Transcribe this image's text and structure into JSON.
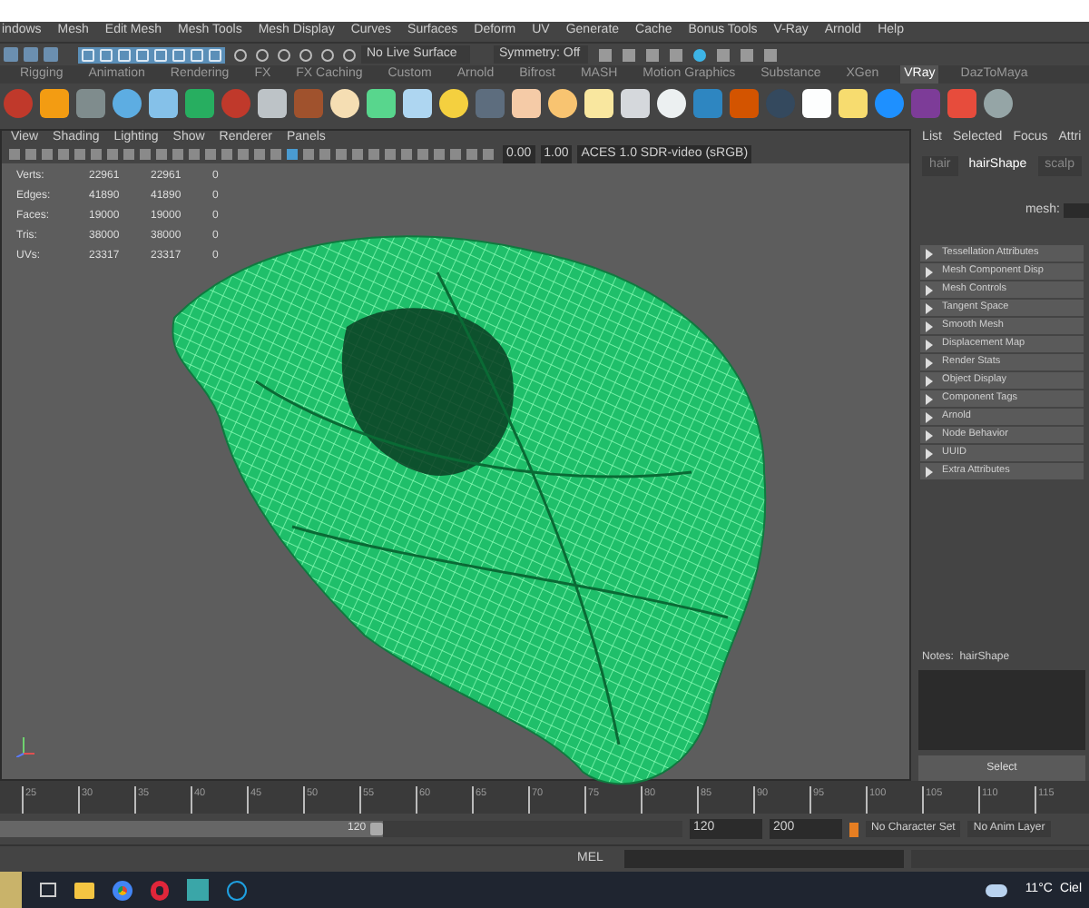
{
  "menu_bar": [
    "indows",
    "Mesh",
    "Edit Mesh",
    "Mesh Tools",
    "Mesh Display",
    "Curves",
    "Surfaces",
    "Deform",
    "UV",
    "Generate",
    "Cache",
    "Bonus Tools",
    "V-Ray",
    "Arnold",
    "Help"
  ],
  "status_line": {
    "live_surface": "No Live Surface",
    "symmetry": "Symmetry: Off"
  },
  "shelf_tabs": [
    {
      "label": "Rigging",
      "selected": false
    },
    {
      "label": "Animation",
      "selected": false
    },
    {
      "label": "Rendering",
      "selected": false
    },
    {
      "label": "FX",
      "selected": false
    },
    {
      "label": "FX Caching",
      "selected": false
    },
    {
      "label": "Custom",
      "selected": false
    },
    {
      "label": "Arnold",
      "selected": false
    },
    {
      "label": "Bifrost",
      "selected": false
    },
    {
      "label": "MASH",
      "selected": false
    },
    {
      "label": "Motion Graphics",
      "selected": false
    },
    {
      "label": "Substance",
      "selected": false
    },
    {
      "label": "XGen",
      "selected": false
    },
    {
      "label": "VRay",
      "selected": true
    },
    {
      "label": "DazToMaya",
      "selected": false
    }
  ],
  "viewport": {
    "menu": [
      "View",
      "Shading",
      "Lighting",
      "Show",
      "Renderer",
      "Panels"
    ],
    "color_management": {
      "exposure": "0.00",
      "gamma": "1.00",
      "view": "ACES 1.0 SDR-video (sRGB)"
    },
    "hud": [
      {
        "label": "Verts:",
        "column_2": "22961",
        "column_3": "22961",
        "column_4": "0"
      },
      {
        "label": "Edges:",
        "column_2": "41890",
        "column_3": "41890",
        "column_4": "0"
      },
      {
        "label": "Faces:",
        "column_2": "19000",
        "column_3": "19000",
        "column_4": "0"
      },
      {
        "label": "Tris:",
        "column_2": "38000",
        "column_3": "38000",
        "column_4": "0"
      },
      {
        "label": "UVs:",
        "column_2": "23317",
        "column_3": "23317",
        "column_4": "0"
      }
    ]
  },
  "attribute_editor": {
    "menu": [
      "List",
      "Selected",
      "Focus",
      "Attri"
    ],
    "tabs": [
      {
        "label": "hair",
        "selected": false
      },
      {
        "label": "hairShape",
        "selected": true
      },
      {
        "label": "scalp",
        "selected": false
      }
    ],
    "mesh_label": "mesh:",
    "sections": [
      "Tessellation Attributes",
      "Mesh Component Disp",
      "Mesh Controls",
      "Tangent Space",
      "Smooth Mesh",
      "Displacement Map",
      "Render Stats",
      "Object Display",
      "Component Tags",
      "Arnold",
      "Node Behavior",
      "UUID",
      "Extra Attributes"
    ],
    "notes_label": "Notes:  hairShape",
    "select_button": "Select"
  },
  "timeline": [
    "25",
    "30",
    "35",
    "40",
    "45",
    "50",
    "55",
    "60",
    "65",
    "70",
    "75",
    "80",
    "85",
    "90",
    "95",
    "100",
    "105",
    "110",
    "115"
  ],
  "range": {
    "level": 0.56,
    "current": "120",
    "start": "120",
    "end": "200",
    "character_set": "No Character Set",
    "anim_layer": "No Anim Layer"
  },
  "command_line": {
    "language": "MEL"
  },
  "taskbar": {
    "temperature": "11°C",
    "weather": "Ciel"
  }
}
